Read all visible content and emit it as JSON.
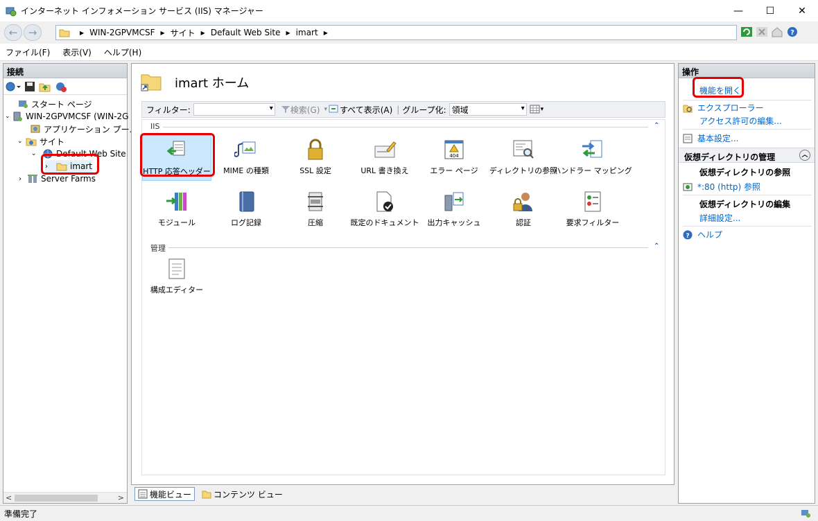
{
  "window": {
    "title": "インターネット インフォメーション サービス (IIS) マネージャー",
    "minimize": "—",
    "maximize": "☐",
    "close": "✕"
  },
  "address": {
    "crumbs": [
      "WIN-2GPVMCSF",
      "サイト",
      "Default Web Site",
      "imart"
    ]
  },
  "menu": {
    "file": "ファイル(F)",
    "view": "表示(V)",
    "help": "ヘルプ(H)"
  },
  "connections": {
    "header": "接続",
    "tree": {
      "start_page": "スタート ページ",
      "server": "WIN-2GPVMCSF (WIN-2G",
      "app_pools": "アプリケーション プール",
      "sites": "サイト",
      "default_site": "Default Web Site",
      "imart": "imart",
      "server_farms": "Server Farms"
    }
  },
  "main": {
    "title": "imart ホーム",
    "filter_label": "フィルター:",
    "search": "検索(G)",
    "show_all": "すべて表示(A)",
    "group_label": "グループ化:",
    "group_value": "領域",
    "section_iis": "IIS",
    "section_mgmt": "管理",
    "features_iis": [
      "HTTP 応答ヘッダー",
      "MIME の種類",
      "SSL 設定",
      "URL 書き換え",
      "エラー ページ",
      "ディレクトリの参照",
      "ハンドラー マッピング",
      "モジュール",
      "ログ記録",
      "圧縮",
      "既定のドキュメント",
      "出力キャッシュ",
      "認証",
      "要求フィルター"
    ],
    "features_mgmt": [
      "構成エディター"
    ],
    "error_icon_text": "404",
    "view_features": "機能ビュー",
    "view_content": "コンテンツ ビュー"
  },
  "actions": {
    "header": "操作",
    "open_feature": "機能を開く",
    "explore": "エクスプローラー",
    "edit_permissions": "アクセス許可の編集...",
    "basic_settings": "基本設定...",
    "vdir_header": "仮想ディレクトリの管理",
    "browse_vdir": "仮想ディレクトリの参照",
    "browse_80": "*:80 (http) 参照",
    "edit_vdir": "仮想ディレクトリの編集",
    "advanced_settings": "詳細設定...",
    "help": "ヘルプ"
  },
  "status": {
    "text": "準備完了"
  },
  "colors": {
    "highlight": "#e40000",
    "link": "#0066cc",
    "selection": "#cce8ff"
  }
}
